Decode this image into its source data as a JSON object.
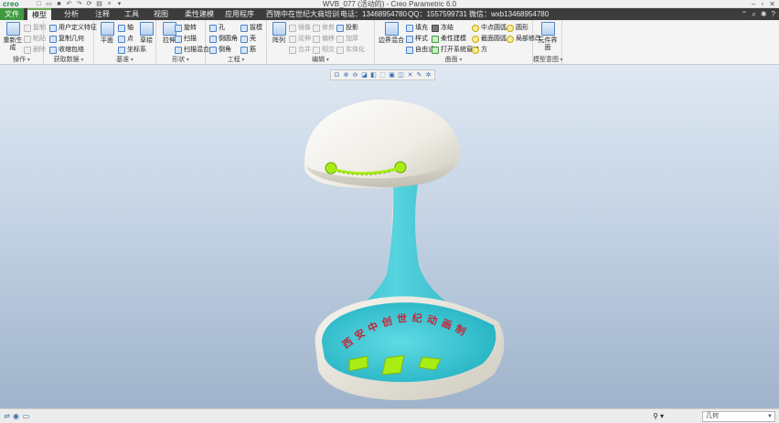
{
  "app": {
    "logo": "creo",
    "window_title": "WVB_077 (活动的) - Creo Parametric 6.0"
  },
  "quick_access": [
    "new-icon",
    "open-icon",
    "save-icon",
    "undo-icon",
    "redo-icon",
    "regenerate-icon",
    "windows-icon",
    "close-icon",
    "customize-icon"
  ],
  "tabs": [
    {
      "label": "文件"
    },
    {
      "label": "模型"
    },
    {
      "label": "分析"
    },
    {
      "label": "注释"
    },
    {
      "label": "工具"
    },
    {
      "label": "视图"
    },
    {
      "label": "柔性建模"
    },
    {
      "label": "应用程序"
    },
    {
      "label": "西锦中在世纪大商培训"
    },
    {
      "label": "电话：13468954780"
    },
    {
      "label": "QQ：1557599731"
    },
    {
      "label": "微信：wxb13468954780"
    }
  ],
  "active_tab": "模型",
  "ribbon": {
    "groups": {
      "operations": "操作",
      "get_data": "获取数据",
      "datum": "基准",
      "shapes": "形状",
      "engineering": "工程",
      "editing": "编辑",
      "surfaces": "曲面",
      "model_intent": "模型意图"
    },
    "regenerate": "重新生成",
    "copy": "复制",
    "paste": "粘贴",
    "delete": "删除",
    "user_defined_feature": "用户定义特征",
    "copy_geometry": "复制几何",
    "shrinkwrap": "收缩包络",
    "plane": "平面",
    "axis": "轴",
    "point": "点",
    "coord_sys": "坐标系",
    "sketch": "草绘",
    "extrude": "拉伸",
    "revolve": "旋转",
    "sweep": "扫描",
    "swept_blend": "扫描混合",
    "hole": "孔",
    "round": "倒圆角",
    "chamfer": "倒角",
    "draft": "拔模",
    "shell": "壳",
    "rib": "筋",
    "pattern": "阵列",
    "mirror": "镜像",
    "extend": "延伸",
    "trim": "修剪",
    "merge": "合并",
    "intersect": "相交",
    "offset": "偏移",
    "thicken": "加厚",
    "project": "投影",
    "solidify": "实体化",
    "boundary_blend": "边界混合",
    "fill": "填充",
    "style": "样式",
    "freestyle": "自由式",
    "freeze": "冻结",
    "flexible": "柔性建模",
    "open_system_window": "打开系统窗口",
    "front": "中点圆弧",
    "grid": "截面圆弧",
    "square": "方",
    "perimeter": "圆形",
    "local": "局部修改",
    "component_interface": "元件界面"
  },
  "statusbar": {
    "filter_value": "几何"
  },
  "model": {
    "banner_text": "西安中创世纪动画制作",
    "body_color": "#f2f0e8",
    "cyan_color": "#33c3cf",
    "lime_color": "#a8ee14"
  }
}
